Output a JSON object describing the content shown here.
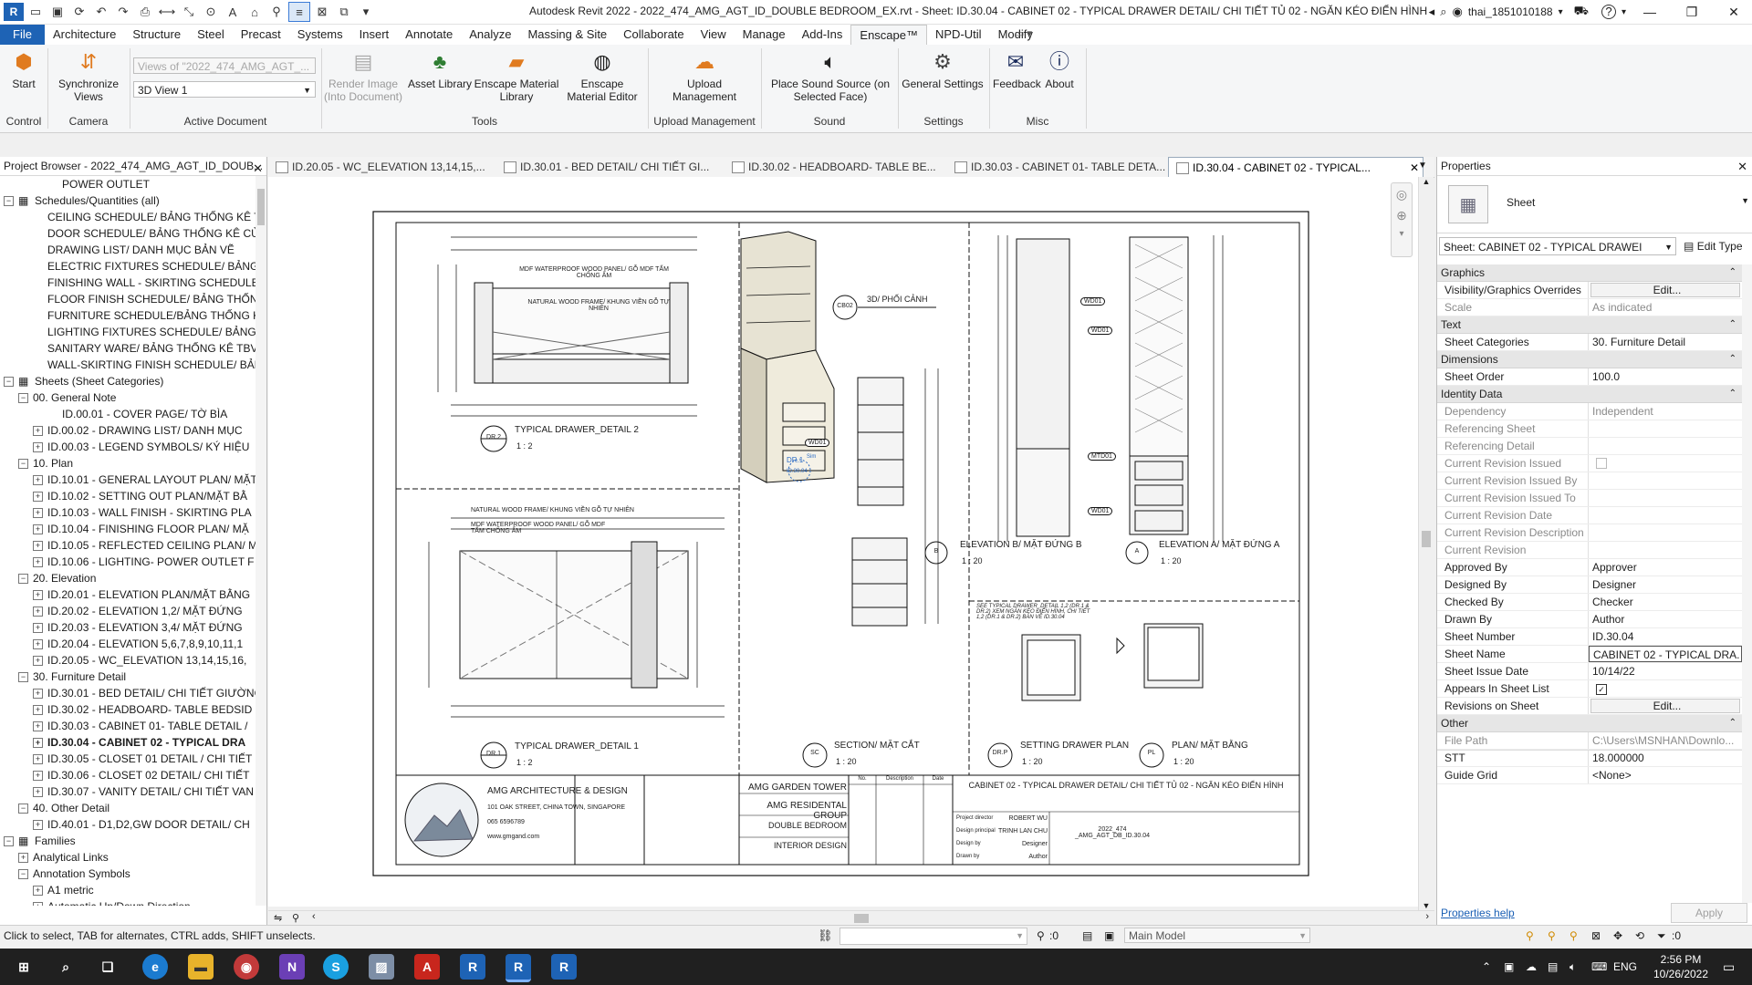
{
  "window": {
    "title": "Autodesk Revit 2022 - 2022_474_AMG_AGT_ID_DOUBLE BEDROOM_EX.rvt - Sheet: ID.30.04 - CABINET 02 - TYPICAL DRAWER DETAIL/ CHI TIẾT TỦ 02 - NGĂN KÉO ĐIỂN HÌNH",
    "user": "thai_1851010188",
    "help": "?"
  },
  "ribbon_tabs": [
    "File",
    "Architecture",
    "Structure",
    "Steel",
    "Precast",
    "Systems",
    "Insert",
    "Annotate",
    "Analyze",
    "Massing & Site",
    "Collaborate",
    "View",
    "Manage",
    "Add-Ins",
    "Enscape™",
    "NPD-Util",
    "Modify"
  ],
  "ribbon": {
    "start": "Start",
    "sync_views": "Synchronize Views",
    "views_combo_placeholder": "Views of \"2022_474_AMG_AGT_...",
    "view_combo": "3D View 1",
    "render_image": "Render Image (Into Document)",
    "asset_library": "Asset Library",
    "material_library": "Enscape Material Library",
    "material_editor": "Enscape Material Editor",
    "upload": "Upload Management",
    "sound": "Place Sound Source (on Selected Face)",
    "settings": "General Settings",
    "feedback": "Feedback",
    "about": "About",
    "panels": {
      "control": "Control",
      "camera": "Camera",
      "active_document": "Active Document",
      "tools": "Tools",
      "upload_management": "Upload Management",
      "sound": "Sound",
      "settings": "Settings",
      "misc": "Misc"
    }
  },
  "project_browser": {
    "title": "Project Browser - 2022_474_AMG_AGT_ID_DOUB...",
    "items": [
      {
        "indent": 3,
        "label": "POWER OUTLET",
        "toggle": ""
      },
      {
        "indent": 0,
        "label": "Schedules/Quantities (all)",
        "toggle": "−",
        "icon": true
      },
      {
        "indent": 2,
        "label": "CEILING SCHEDULE/ BẢNG THỐNG KÊ TRẦN",
        "toggle": ""
      },
      {
        "indent": 2,
        "label": "DOOR SCHEDULE/ BẢNG THỐNG KÊ CỬA",
        "toggle": ""
      },
      {
        "indent": 2,
        "label": "DRAWING LIST/ DANH MỤC BẢN VẼ",
        "toggle": ""
      },
      {
        "indent": 2,
        "label": "ELECTRIC FIXTURES SCHEDULE/ BẢNG THỐNG KÊ",
        "toggle": ""
      },
      {
        "indent": 2,
        "label": "FINISHING WALL - SKIRTING SCHEDULE",
        "toggle": ""
      },
      {
        "indent": 2,
        "label": "FLOOR FINISH SCHEDULE/ BẢNG THỐNG KÊ",
        "toggle": ""
      },
      {
        "indent": 2,
        "label": "FURNITURE SCHEDULE/BẢNG THỐNG KÊ ĐỒ",
        "toggle": ""
      },
      {
        "indent": 2,
        "label": "LIGHTING FIXTURES SCHEDULE/ BẢNG THỐNG",
        "toggle": ""
      },
      {
        "indent": 2,
        "label": "SANITARY WARE/ BẢNG THỐNG KÊ TBVS",
        "toggle": ""
      },
      {
        "indent": 2,
        "label": "WALL-SKIRTING FINISH SCHEDULE/ BẢNG T",
        "toggle": ""
      },
      {
        "indent": 0,
        "label": "Sheets (Sheet Categories)",
        "toggle": "−",
        "icon": true
      },
      {
        "indent": 1,
        "label": "00. General Note",
        "toggle": "−"
      },
      {
        "indent": 3,
        "label": "ID.00.01 - COVER PAGE/ TỜ BÌA",
        "toggle": ""
      },
      {
        "indent": 2,
        "label": "ID.00.02 - DRAWING LIST/ DANH MỤC",
        "toggle": "+"
      },
      {
        "indent": 2,
        "label": "ID.00.03 - LEGEND SYMBOLS/ KÝ HIỆU",
        "toggle": "+"
      },
      {
        "indent": 1,
        "label": "10. Plan",
        "toggle": "−"
      },
      {
        "indent": 2,
        "label": "ID.10.01 - GENERAL LAYOUT PLAN/ MẶT",
        "toggle": "+"
      },
      {
        "indent": 2,
        "label": "ID.10.02 - SETTING OUT PLAN/MẶT BẰ",
        "toggle": "+"
      },
      {
        "indent": 2,
        "label": "ID.10.03 - WALL FINISH - SKIRTING PLA",
        "toggle": "+"
      },
      {
        "indent": 2,
        "label": "ID.10.04 - FINISHING FLOOR PLAN/ MẶ",
        "toggle": "+"
      },
      {
        "indent": 2,
        "label": "ID.10.05 - REFLECTED CEILING PLAN/ M",
        "toggle": "+"
      },
      {
        "indent": 2,
        "label": "ID.10.06 - LIGHTING- POWER OUTLET F",
        "toggle": "+"
      },
      {
        "indent": 1,
        "label": "20. Elevation",
        "toggle": "−"
      },
      {
        "indent": 2,
        "label": "ID.20.01 - ELEVATION PLAN/MẶT BẰNG",
        "toggle": "+"
      },
      {
        "indent": 2,
        "label": "ID.20.02 - ELEVATION 1,2/ MẶT ĐỨNG",
        "toggle": "+"
      },
      {
        "indent": 2,
        "label": "ID.20.03 - ELEVATION 3,4/ MẶT ĐỨNG",
        "toggle": "+"
      },
      {
        "indent": 2,
        "label": "ID.20.04 - ELEVATION 5,6,7,8,9,10,11,1",
        "toggle": "+"
      },
      {
        "indent": 2,
        "label": "ID.20.05 - WC_ELEVATION 13,14,15,16,",
        "toggle": "+"
      },
      {
        "indent": 1,
        "label": "30. Furniture Detail",
        "toggle": "−"
      },
      {
        "indent": 2,
        "label": "ID.30.01 - BED DETAIL/ CHI TIẾT GIƯỜNG",
        "toggle": "+"
      },
      {
        "indent": 2,
        "label": "ID.30.02 - HEADBOARD- TABLE BEDSID",
        "toggle": "+"
      },
      {
        "indent": 2,
        "label": "ID.30.03 - CABINET 01- TABLE DETAIL /",
        "toggle": "+"
      },
      {
        "indent": 2,
        "label": "ID.30.04 - CABINET 02 - TYPICAL DRA",
        "toggle": "+",
        "selected": true
      },
      {
        "indent": 2,
        "label": "ID.30.05 - CLOSET 01 DETAIL / CHI TIẾT",
        "toggle": "+"
      },
      {
        "indent": 2,
        "label": "ID.30.06 - CLOSET 02 DETAIL/ CHI TIẾT",
        "toggle": "+"
      },
      {
        "indent": 2,
        "label": "ID.30.07 - VANITY DETAIL/ CHI TIẾT VAN",
        "toggle": "+"
      },
      {
        "indent": 1,
        "label": "40. Other Detail",
        "toggle": "−"
      },
      {
        "indent": 2,
        "label": "ID.40.01 - D1,D2,GW DOOR DETAIL/ CH",
        "toggle": "+"
      },
      {
        "indent": 0,
        "label": "Families",
        "toggle": "−",
        "icon": true
      },
      {
        "indent": 1,
        "label": "Analytical Links",
        "toggle": "+"
      },
      {
        "indent": 1,
        "label": "Annotation Symbols",
        "toggle": "−"
      },
      {
        "indent": 2,
        "label": "A1 metric",
        "toggle": "+"
      },
      {
        "indent": 2,
        "label": "Automatic Up/Down Direction",
        "toggle": "+"
      }
    ]
  },
  "doc_tabs": [
    {
      "label": "ID.20.05 - WC_ELEVATION 13,14,15,..."
    },
    {
      "label": "ID.30.01 - BED DETAIL/ CHI TIẾT GI..."
    },
    {
      "label": "ID.30.02 - HEADBOARD- TABLE BE..."
    },
    {
      "label": "ID.30.03 - CABINET 01- TABLE DETA..."
    },
    {
      "label": "ID.30.04 - CABINET 02 - TYPICAL...",
      "active": true
    }
  ],
  "sheet": {
    "views": {
      "drawer2_title": "TYPICAL DRAWER_DETAIL 2",
      "drawer2_scale": "1 : 2",
      "drawer2_tag": "DR.2",
      "drawer1_title": "TYPICAL DRAWER_DETAIL 1",
      "drawer1_scale": "1 : 2",
      "drawer1_tag": "DR.1",
      "persp_tag": "CB02",
      "persp_title": "3D/ PHỐI CẢNH",
      "section_title": "SECTION/ MẶT CẮT",
      "section_scale": "1 : 20",
      "section_tag": "SC",
      "elevB_title": "ELEVATION B/ MẶT ĐỨNG B",
      "elevB_scale": "1 : 20",
      "elevB_tag": "B",
      "elevA_title": "ELEVATION A/ MẶT ĐỨNG A",
      "elevA_scale": "1 : 20",
      "elevA_tag": "A",
      "setting_title": "SETTING DRAWER PLAN",
      "setting_scale": "1 : 20",
      "setting_tag": "DR.P",
      "plan_title": "PLAN/ MẶT BẰNG",
      "plan_scale": "1 : 20",
      "plan_tag": "PL",
      "note_mdf": "MDF WATERPROOF WOOD PANEL/ GỖ MDF TẤM CHỐNG ẨM",
      "note_frame": "NATURAL WOOD FRAME/ KHUNG VIỀN GỖ TỰ NHIÊN",
      "note_see": "SEE TYPICAL DRAWER_DETAIL 1,2 (DR.1 & DR.2) XEM NGĂN KÉO ĐIỂN HÌNH, CHI TIẾT 1,2 (DR.1 & DR.2) BẢN VẼ ID.30.04",
      "tag_wd01": "WD01",
      "tag_mtd01": "MTD01",
      "dr1_callout": "DR.1",
      "dr1_callout_sheet": "ID.30.04",
      "dr1_callout_note": "Sim"
    },
    "titleblock": {
      "company": "AMG ARCHITECTURE & DESIGN",
      "address": "101 OAK STREET, CHINA TOWN, SINGAPORE",
      "phone": "065 6596789",
      "web": "www.gmgand.com",
      "project1": "AMG GARDEN TOWER",
      "project2": "AMG RESIDENTAL GROUP",
      "room": "DOUBLE BEDROOM",
      "discipline": "INTERIOR DESIGN",
      "sheet_title": "CABINET 02 - TYPICAL DRAWER DETAIL/ CHI TIẾT TỦ 02 - NGĂN KÉO ĐIỂN HÌNH",
      "project_director_label": "Project director",
      "project_director": "ROBERT WU",
      "principal_label": "Design principal",
      "principal": "TRINH LAN CHU",
      "design_by_label": "Design by",
      "design_by": "Designer",
      "drawn_by_label": "Drawn by",
      "drawn_by": "Author",
      "number": "2022_474 _AMG_AGT_DB_ID.30.04",
      "rev_no": "No.",
      "rev_desc": "Description",
      "rev_date": "Date"
    }
  },
  "properties": {
    "title": "Properties",
    "type_name": "Sheet",
    "selector": "Sheet: CABINET 02 - TYPICAL DRAWEI",
    "edit_type": "Edit Type",
    "sections": [
      {
        "name": "Graphics",
        "rows": [
          {
            "label": "Visibility/Graphics Overrides",
            "value": "Edit...",
            "kind": "btn"
          },
          {
            "label": "Scale",
            "value": "As indicated",
            "kind": "ro"
          }
        ]
      },
      {
        "name": "Text",
        "rows": [
          {
            "label": "Sheet Categories",
            "value": "30. Furniture Detail"
          }
        ]
      },
      {
        "name": "Dimensions",
        "rows": [
          {
            "label": "Sheet Order",
            "value": "100.0"
          }
        ]
      },
      {
        "name": "Identity Data",
        "rows": [
          {
            "label": "Dependency",
            "value": "Independent",
            "kind": "ro"
          },
          {
            "label": "Referencing Sheet",
            "value": "",
            "kind": "ro"
          },
          {
            "label": "Referencing Detail",
            "value": "",
            "kind": "ro"
          },
          {
            "label": "Current Revision Issued",
            "value": "",
            "kind": "ro-check"
          },
          {
            "label": "Current Revision Issued By",
            "value": "",
            "kind": "ro"
          },
          {
            "label": "Current Revision Issued To",
            "value": "",
            "kind": "ro"
          },
          {
            "label": "Current Revision Date",
            "value": "",
            "kind": "ro"
          },
          {
            "label": "Current Revision Description",
            "value": "",
            "kind": "ro"
          },
          {
            "label": "Current Revision",
            "value": "",
            "kind": "ro"
          },
          {
            "label": "Approved By",
            "value": "Approver"
          },
          {
            "label": "Designed By",
            "value": "Designer"
          },
          {
            "label": "Checked By",
            "value": "Checker"
          },
          {
            "label": "Drawn By",
            "value": "Author"
          },
          {
            "label": "Sheet Number",
            "value": "ID.30.04"
          },
          {
            "label": "Sheet Name",
            "value": "CABINET 02 - TYPICAL DRA.",
            "kind": "edit"
          },
          {
            "label": "Sheet Issue Date",
            "value": "10/14/22"
          },
          {
            "label": "Appears In Sheet List",
            "value": "",
            "kind": "check"
          },
          {
            "label": "Revisions on Sheet",
            "value": "Edit...",
            "kind": "btn"
          }
        ]
      },
      {
        "name": "Other",
        "rows": [
          {
            "label": "File Path",
            "value": "C:\\Users\\MSNHAN\\Downlo...",
            "kind": "ro"
          },
          {
            "label": "STT",
            "value": "18.000000"
          },
          {
            "label": "Guide Grid",
            "value": "<None>"
          }
        ]
      }
    ],
    "help": "Properties help",
    "apply": "Apply"
  },
  "status": {
    "hint": "Click to select, TAB for alternates, CTRL adds, SHIFT unselects.",
    "count": ":0",
    "model": "Main Model",
    "filter_count": ":0"
  },
  "taskbar": {
    "lang": "ENG",
    "time": "2:56 PM",
    "date": "10/26/2022"
  },
  "colors": {
    "file_tab": "#1e63b5",
    "taskbar": "#202020",
    "link": "#1a5fb4"
  }
}
